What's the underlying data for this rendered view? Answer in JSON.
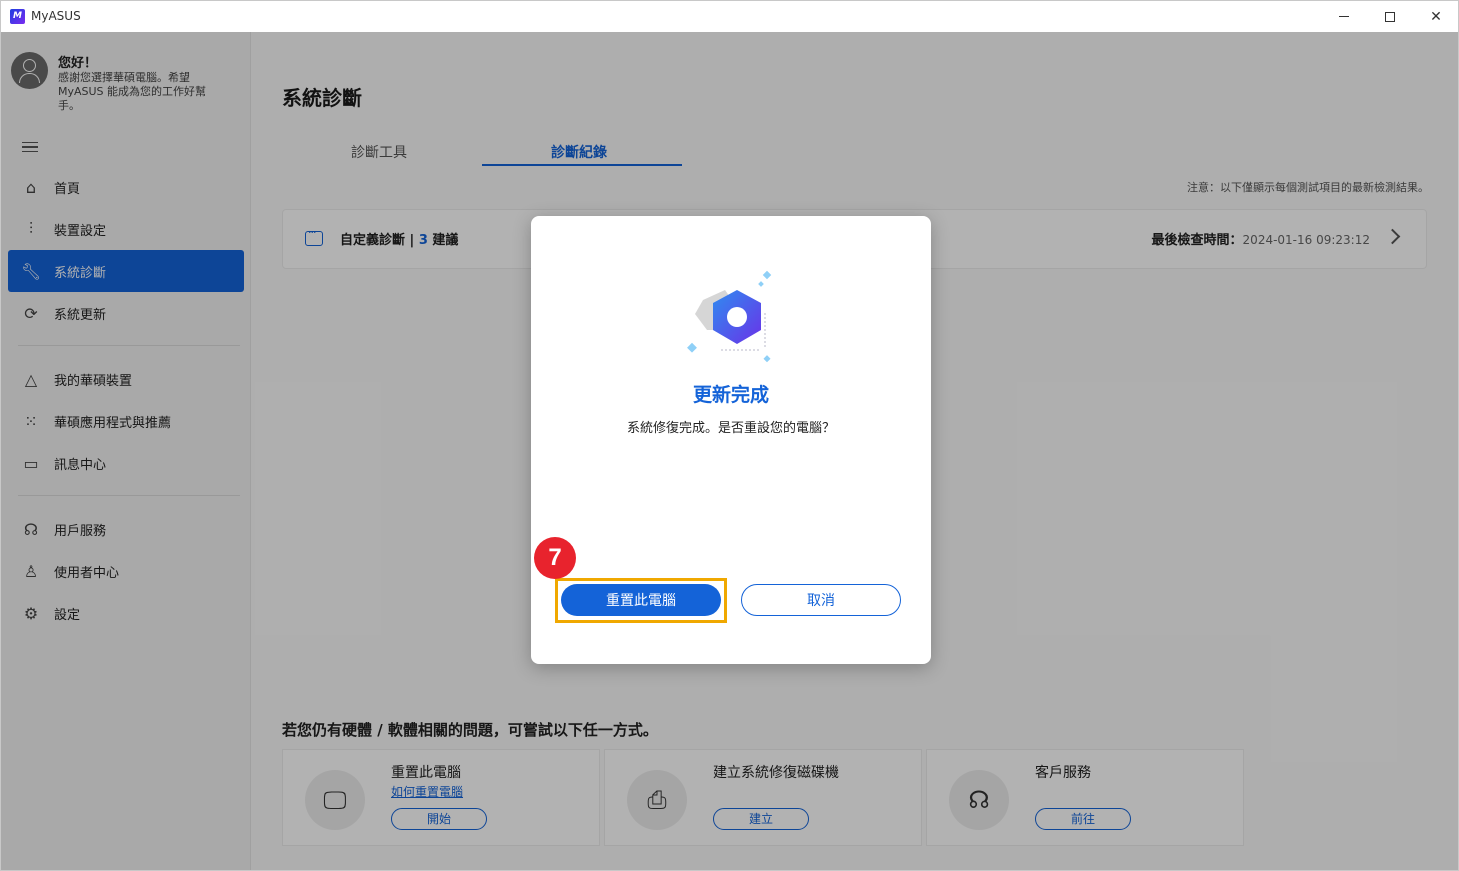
{
  "window": {
    "app_title": "MyASUS",
    "logo_text": "M"
  },
  "sidebar": {
    "hello": "您好！",
    "greeting": "感謝您選擇華碩電腦。希望 MyASUS 能成為您的工作好幫手。",
    "items": [
      {
        "label": "首頁",
        "icon": "home-icon"
      },
      {
        "label": "裝置設定",
        "icon": "sliders-icon"
      },
      {
        "label": "系統診斷",
        "icon": "wrench-icon",
        "active": true
      },
      {
        "label": "系統更新",
        "icon": "update-icon"
      },
      {
        "label": "我的華碩裝置",
        "icon": "devices-icon"
      },
      {
        "label": "華碩應用程式與推薦",
        "icon": "grid-icon"
      },
      {
        "label": "訊息中心",
        "icon": "message-icon"
      },
      {
        "label": "用戶服務",
        "icon": "headset-icon"
      },
      {
        "label": "使用者中心",
        "icon": "user-icon"
      },
      {
        "label": "設定",
        "icon": "gear-icon"
      }
    ]
  },
  "main": {
    "title": "系統診斷",
    "tabs": [
      {
        "label": "診斷工具"
      },
      {
        "label": "診斷紀錄",
        "active": true
      }
    ],
    "note": "注意：以下僅顯示每個測試項目的最新檢測結果。",
    "record": {
      "label": "自定義診斷",
      "separator": " | ",
      "count": "3",
      "suggestions": " 建議",
      "time_label": "最後檢查時間：",
      "time": "2024-01-16 09:23:12"
    },
    "help_title": "若您仍有硬體 / 軟體相關的問題，可嘗試以下任一方式。",
    "help_cards": [
      {
        "title": "重置此電腦",
        "link": "如何重置電腦",
        "button": "開始",
        "icon": "reset-pc-icon"
      },
      {
        "title": "建立系統修復磁碟機",
        "link": "",
        "button": "建立",
        "icon": "recovery-drive-icon"
      },
      {
        "title": "客戶服務",
        "link": "",
        "button": "前往",
        "icon": "headset-icon"
      }
    ]
  },
  "dialog": {
    "title": "更新完成",
    "message": "系統修復完成。是否重設您的電腦？",
    "primary_button": "重置此電腦",
    "secondary_button": "取消",
    "step_badge": "7"
  },
  "colors": {
    "accent": "#1463d8",
    "highlight": "#f0a800",
    "badge": "#e8232d"
  }
}
